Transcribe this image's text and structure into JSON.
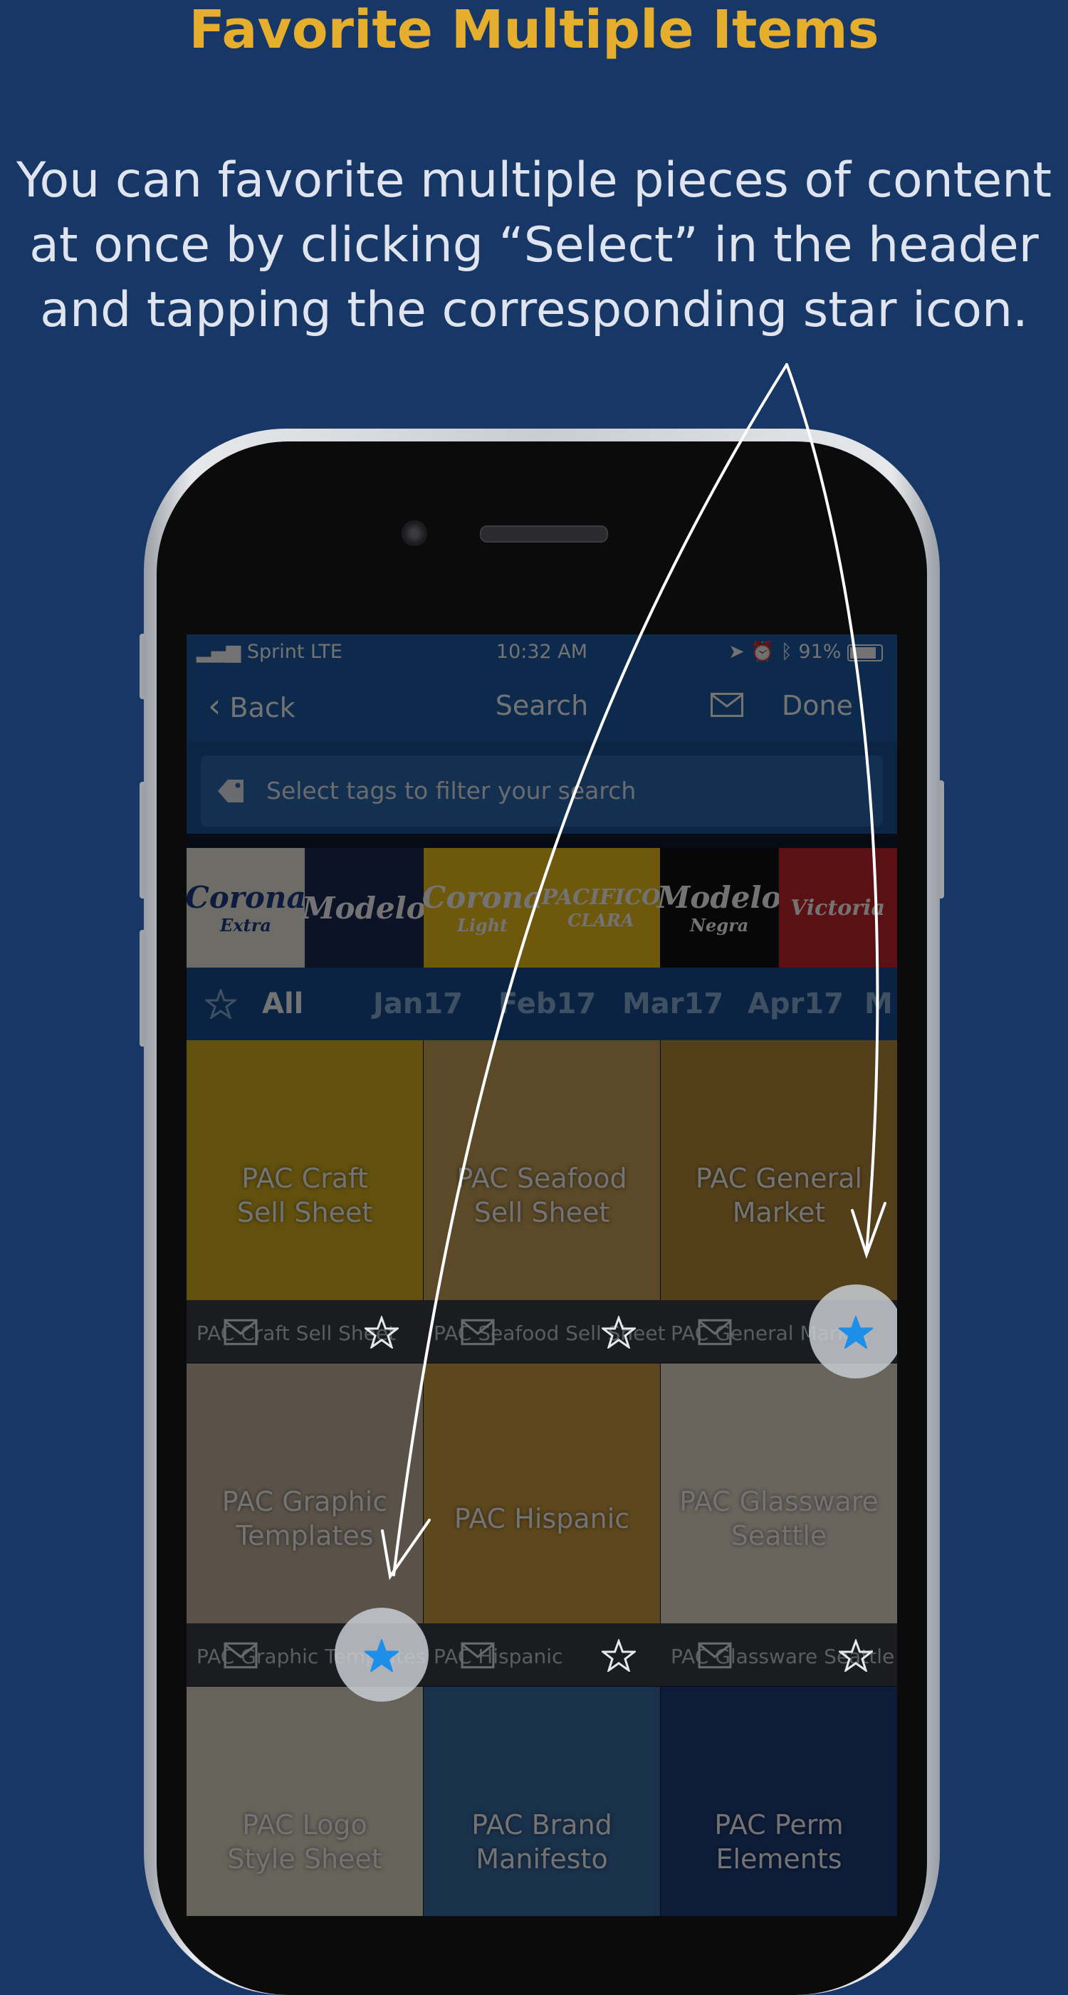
{
  "promo": {
    "headline": "Favorite Multiple Items",
    "subtext": "You can favorite multiple pieces of content at once by clicking “Select” in the header and tapping the corresponding star icon."
  },
  "status_bar": {
    "carrier": "Sprint  LTE",
    "time": "10:32 AM",
    "battery": "91%"
  },
  "nav": {
    "back_label": "Back",
    "title": "Search",
    "done_label": "Done"
  },
  "search": {
    "placeholder": "Select tags to filter your search"
  },
  "brands": [
    {
      "name": "Corona",
      "sub": "Extra",
      "bg": "#f3efe2",
      "fg": "#1c3d8a"
    },
    {
      "name": "Modelo",
      "sub": "",
      "bg": "#1d2b57",
      "fg": "#ffffff"
    },
    {
      "name": "Corona",
      "sub": "Light",
      "bg": "#f3c41c",
      "fg": "#ffffff"
    },
    {
      "name": "PACIFICO",
      "sub": "CLARA",
      "bg": "#f3c41c",
      "fg": "#ffffff"
    },
    {
      "name": "Modelo",
      "sub": "Negra",
      "bg": "#111111",
      "fg": "#ffffff"
    },
    {
      "name": "Victoria",
      "sub": "",
      "bg": "#c8262a",
      "fg": "#ffffff"
    }
  ],
  "filter": {
    "all_label": "All",
    "months": [
      "Jan17",
      "Feb17",
      "Mar17",
      "Apr17",
      "M"
    ]
  },
  "grid": [
    [
      {
        "title_line1": "PAC Craft",
        "title_line2": "Sell Sheet",
        "caption": "PAC Craft Sell Sheet",
        "favorited": false,
        "bg": "#d9b21f"
      },
      {
        "title_line1": "PAC Seafood",
        "title_line2": "Sell Sheet",
        "caption": "PAC Seafood Sell Sheet",
        "favorited": false,
        "bg": "#c9a257"
      },
      {
        "title_line1": "PAC General",
        "title_line2": "Market",
        "caption": "PAC General Market",
        "favorited": true,
        "bg": "#b98e3a"
      }
    ],
    [
      {
        "title_line1": "PAC Graphic",
        "title_line2": "Templates",
        "caption": "PAC Graphic Templates",
        "favorited": true,
        "bg": "#c7b6a0"
      },
      {
        "title_line1": "PAC Hispanic",
        "title_line2": "",
        "caption": "PAC Hispanic",
        "favorited": false,
        "bg": "#cf9d3f"
      },
      {
        "title_line1": "PAC Glassware",
        "title_line2": "Seattle",
        "caption": "PAC Glassware Seattle",
        "favorited": false,
        "bg": "#e8dfcf"
      }
    ],
    [
      {
        "title_line1": "PAC Logo",
        "title_line2": "Style Sheet",
        "caption": "",
        "favorited": false,
        "bg": "#e3dccb"
      },
      {
        "title_line1": "PAC Brand",
        "title_line2": "Manifesto",
        "caption": "",
        "favorited": false,
        "bg": "#3a6da8"
      },
      {
        "title_line1": "PAC Perm",
        "title_line2": "Elements",
        "caption": "",
        "favorited": false,
        "bg": "#1f3f80"
      }
    ]
  ],
  "colors": {
    "background": "#173767",
    "headline": "#e5ae2d",
    "star_active": "#1e8fe8",
    "nav_blue": "#1d5ea8"
  }
}
